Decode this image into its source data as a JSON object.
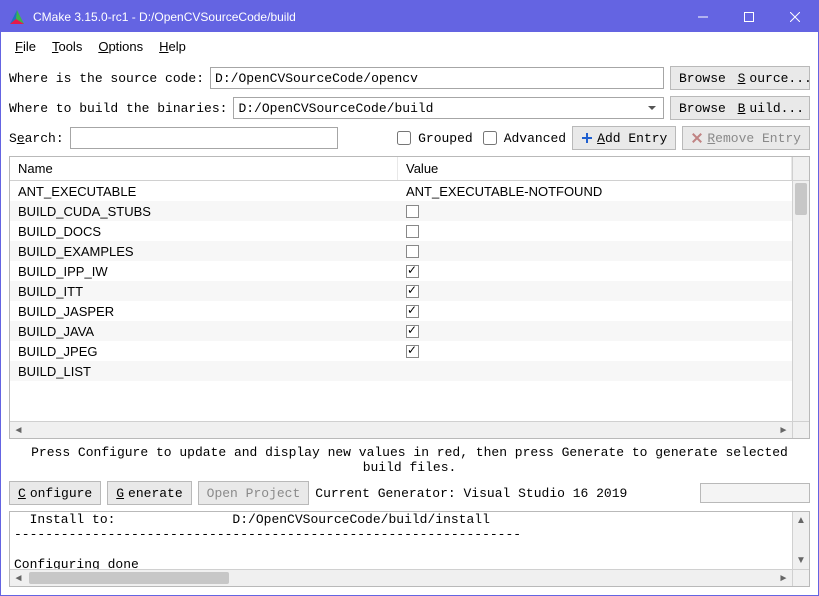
{
  "titlebar": {
    "title": "CMake 3.15.0-rc1 - D:/OpenCVSourceCode/build"
  },
  "menus": {
    "file": "File",
    "tools": "Tools",
    "options": "Options",
    "help": "Help"
  },
  "labels": {
    "source": "Where is the source code:",
    "build": "Where to build the binaries:",
    "search": "Search:",
    "grouped": "Grouped",
    "advanced": "Advanced"
  },
  "inputs": {
    "source_path": "D:/OpenCVSourceCode/opencv",
    "build_path": "D:/OpenCVSourceCode/build",
    "search_text": ""
  },
  "buttons": {
    "browse_source": "Browse Source...",
    "browse_build": "Browse Build...",
    "add_entry": "Add Entry",
    "remove_entry": "Remove Entry",
    "configure": "Configure",
    "generate": "Generate",
    "open_project": "Open Project"
  },
  "table": {
    "columns": {
      "name": "Name",
      "value": "Value"
    },
    "rows": [
      {
        "name": "ANT_EXECUTABLE",
        "type": "text",
        "value": "ANT_EXECUTABLE-NOTFOUND"
      },
      {
        "name": "BUILD_CUDA_STUBS",
        "type": "bool",
        "value": false
      },
      {
        "name": "BUILD_DOCS",
        "type": "bool",
        "value": false
      },
      {
        "name": "BUILD_EXAMPLES",
        "type": "bool",
        "value": false
      },
      {
        "name": "BUILD_IPP_IW",
        "type": "bool",
        "value": true
      },
      {
        "name": "BUILD_ITT",
        "type": "bool",
        "value": true
      },
      {
        "name": "BUILD_JASPER",
        "type": "bool",
        "value": true
      },
      {
        "name": "BUILD_JAVA",
        "type": "bool",
        "value": true
      },
      {
        "name": "BUILD_JPEG",
        "type": "bool",
        "value": true
      },
      {
        "name": "BUILD_LIST",
        "type": "text",
        "value": ""
      }
    ]
  },
  "hint": "Press Configure to update and display new values in red, then press Generate to generate selected build files.",
  "generator_label": "Current Generator: Visual Studio 16 2019",
  "output_lines": [
    "  Install to:               D:/OpenCVSourceCode/build/install",
    "-----------------------------------------------------------------",
    "",
    "Configuring done"
  ]
}
